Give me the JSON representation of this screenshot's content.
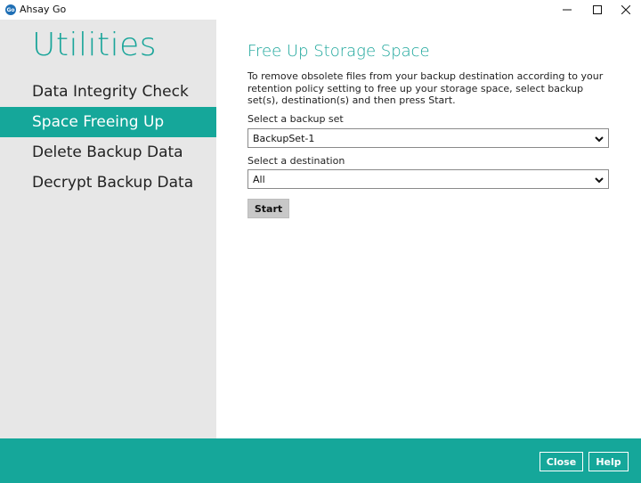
{
  "window": {
    "logo_text": "Go",
    "title": "Ahsay Go",
    "controls": {
      "minimize_icon": "minimize-icon",
      "maximize_icon": "maximize-icon",
      "close_icon": "close-icon"
    }
  },
  "sidebar": {
    "title": "Utilities",
    "items": [
      {
        "label": "Data Integrity Check",
        "active": false
      },
      {
        "label": "Space Freeing Up",
        "active": true
      },
      {
        "label": "Delete Backup Data",
        "active": false
      },
      {
        "label": "Decrypt Backup Data",
        "active": false
      }
    ]
  },
  "main": {
    "title": "Free Up Storage Space",
    "description": "To remove obsolete files from your backup destination according to your retention policy setting to free up your storage space, select backup set(s), destination(s) and then press Start.",
    "backup_set": {
      "label": "Select a backup set",
      "value": "BackupSet-1"
    },
    "destination": {
      "label": "Select a destination",
      "value": "All"
    },
    "start_label": "Start"
  },
  "footer": {
    "close_label": "Close",
    "help_label": "Help"
  },
  "colors": {
    "accent": "#15a79a",
    "sidebar_bg": "#e7e7e7",
    "title_text": "#1aa59a"
  }
}
